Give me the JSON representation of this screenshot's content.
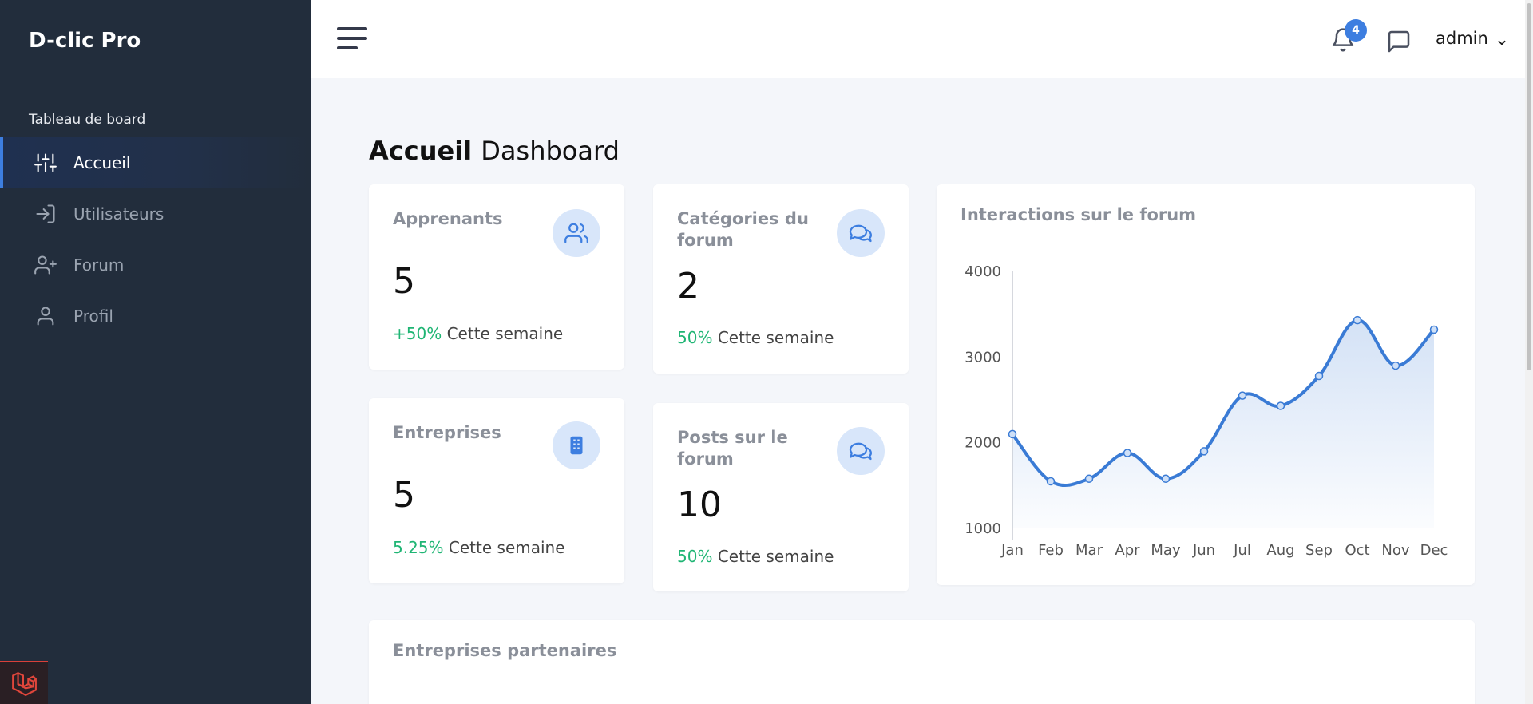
{
  "sidebar": {
    "brand": "D-clic Pro",
    "section_label": "Tableau de board",
    "items": [
      {
        "label": "Accueil",
        "icon": "sliders-icon",
        "active": true
      },
      {
        "label": "Utilisateurs",
        "icon": "login-icon",
        "active": false
      },
      {
        "label": "Forum",
        "icon": "user-plus-icon",
        "active": false
      },
      {
        "label": "Profil",
        "icon": "user-icon",
        "active": false
      }
    ]
  },
  "header": {
    "notification_count": "4",
    "user_name": "admin"
  },
  "page": {
    "title_bold": "Accueil",
    "title_light": "Dashboard"
  },
  "stats": [
    {
      "title": "Apprenants",
      "value": "5",
      "pct": "+50%",
      "period": "Cette semaine",
      "icon": "users-icon"
    },
    {
      "title": "Catégories du forum",
      "value": "2",
      "pct": "50%",
      "period": "Cette semaine",
      "icon": "chat-icon"
    },
    {
      "title": "Entreprises",
      "value": "5",
      "pct": "5.25%",
      "period": "Cette semaine",
      "icon": "building-icon"
    },
    {
      "title": "Posts sur le forum",
      "value": "10",
      "pct": "50%",
      "period": "Cette semaine",
      "icon": "chat-icon"
    }
  ],
  "chart": {
    "title": "Interactions sur le forum"
  },
  "chart_data": {
    "type": "area",
    "title": "Interactions sur le forum",
    "categories": [
      "Jan",
      "Feb",
      "Mar",
      "Apr",
      "May",
      "Jun",
      "Jul",
      "Aug",
      "Sep",
      "Oct",
      "Nov",
      "Dec"
    ],
    "series": [
      {
        "values": [
          2100,
          1550,
          1580,
          1880,
          1580,
          1900,
          2550,
          2430,
          2780,
          3430,
          2900,
          3320
        ]
      }
    ],
    "yticks": [
      1000,
      2000,
      3000,
      4000
    ],
    "ylim": [
      1000,
      4000
    ],
    "color": "#3a7bd5",
    "grid": false
  },
  "partners": {
    "title": "Entreprises partenaires"
  }
}
